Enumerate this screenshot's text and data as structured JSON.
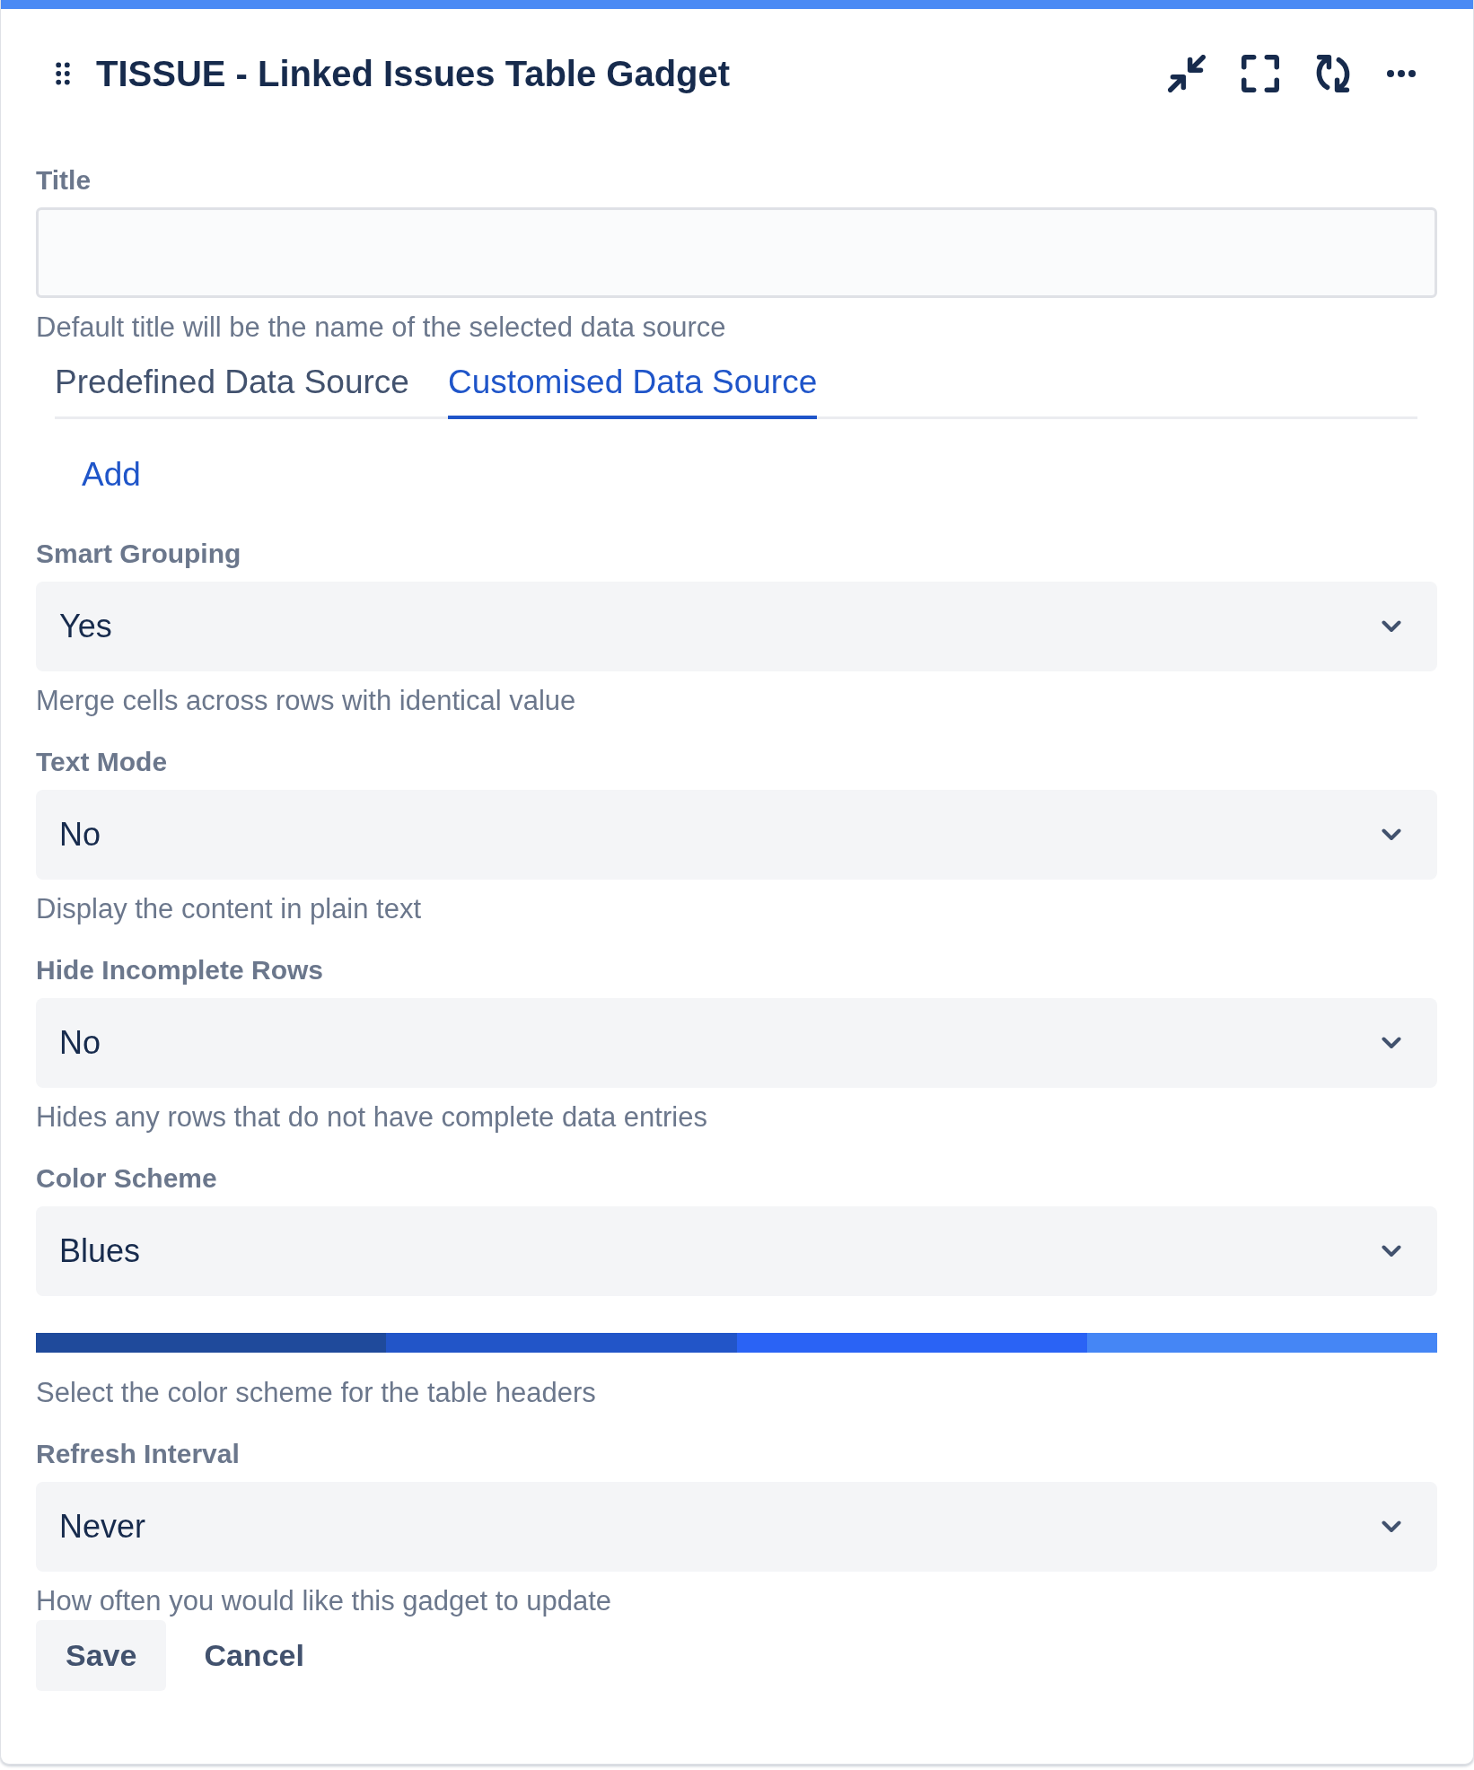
{
  "header": {
    "title": "TISSUE - Linked Issues Table Gadget"
  },
  "title_field": {
    "label": "Title",
    "helper": "Default title will be the name of the selected data source"
  },
  "tabs": [
    {
      "label": "Predefined Data Source",
      "selected": false
    },
    {
      "label": "Customised Data Source",
      "selected": true
    }
  ],
  "add_link": "Add",
  "fields": [
    {
      "label": "Smart Grouping",
      "value": "Yes",
      "helper": "Merge cells across rows with identical value"
    },
    {
      "label": "Text Mode",
      "value": "No",
      "helper": "Display the content in plain text"
    },
    {
      "label": "Hide Incomplete Rows",
      "value": "No",
      "helper": "Hides any rows that do not have complete data entries"
    },
    {
      "label": "Color Scheme",
      "value": "Blues",
      "swatches": [
        {
          "color": "#1f4a9b"
        },
        {
          "color": "#2255c8"
        },
        {
          "color": "#2a63f5"
        },
        {
          "color": "#4586f5"
        }
      ],
      "helper": "Select the color scheme for the table headers"
    },
    {
      "label": "Refresh Interval",
      "value": "Never",
      "helper": "How often you would like this gadget to update"
    }
  ],
  "buttons": [
    {
      "label": "Save",
      "kind": "default"
    },
    {
      "label": "Cancel",
      "kind": "subtle"
    }
  ]
}
